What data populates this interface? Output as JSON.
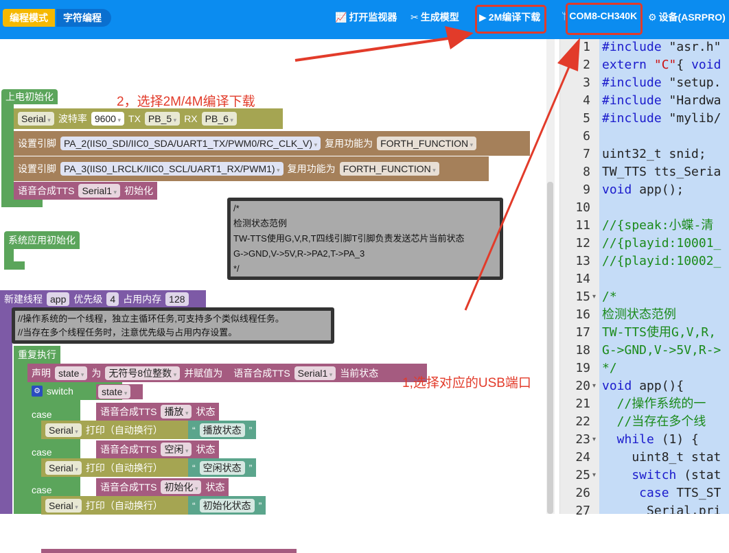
{
  "header": {
    "mode_blocks": "编程模式",
    "mode_text": "字符编程",
    "open_monitor": "打开监视器",
    "generate_model": "生成模型",
    "compile_download": "2M编译下载",
    "port": "COM8-CH340K",
    "device": "设备(ASRPRO)"
  },
  "annotations": {
    "step2": "2，选择2M/4M编译下载",
    "step1": "1,选择对应的USB端口",
    "color": "#e23b2a"
  },
  "blocks": {
    "power_init": "上电初始化",
    "serial": "Serial",
    "baud_label": "波特率",
    "baud": "9600",
    "tx": "TX",
    "tx_pin": "PB_5",
    "rx": "RX",
    "rx_pin": "PB_6",
    "set_pin": "设置引脚",
    "pin1": "PA_2(IIS0_SDI/IIC0_SDA/UART1_TX/PWM0/RC_CLK_V)",
    "reuse": "复用功能为",
    "func": "FORTH_FUNCTION",
    "pin2": "PA_3(IIS0_LRCLK/IIC0_SCL/UART1_RX/PWM1)",
    "tts": "语音合成TTS",
    "serial1": "Serial1",
    "init": "初始化",
    "sys_init": "系统应用初始化",
    "comment1": "/*\n检测状态范例\nTW-TTS使用G,V,R,T四线引脚T引脚负责发送芯片当前状态\nG->GND,V->5V,R->PA2,T->PA_3\n*/",
    "new_thread": "新建线程",
    "thread_name": "app",
    "priority": "优先级",
    "priority_val": "4",
    "memory": "占用内存",
    "memory_val": "128",
    "comment2": "//操作系统的一个线程，独立主循环任务,可支持多个类似线程任务。\n//当存在多个线程任务时，注意优先级与占用内存设置。",
    "repeat": "重复执行",
    "declare": "声明",
    "var": "state",
    "as": "为",
    "type": "无符号8位整数",
    "assign": "并赋值为",
    "current_state": "当前状态",
    "switch": "switch",
    "case": "case",
    "state_suffix": "状态",
    "print": "打印（自动换行）",
    "lq": "“",
    "rq": "”",
    "cases": [
      {
        "state": "播放",
        "text": "播放状态"
      },
      {
        "state": "空闲",
        "text": "空闲状态"
      },
      {
        "state": "初始化",
        "text": "初始化状态"
      }
    ]
  },
  "code": {
    "line_numbers": [
      "1",
      "2",
      "3",
      "4",
      "5",
      "6",
      "7",
      "8",
      "9",
      "10",
      "11",
      "12",
      "13",
      "14",
      "15",
      "16",
      "17",
      "18",
      "19",
      "20",
      "21",
      "22",
      "23",
      "24",
      "25",
      "26",
      "27"
    ],
    "folds": [
      15,
      20,
      23,
      25
    ],
    "lines": [
      [
        [
          "kw",
          "#include "
        ],
        [
          "str",
          "\"asr.h\""
        ]
      ],
      [
        [
          "kw",
          "extern "
        ],
        [
          "red",
          "\"C\""
        ],
        [
          "pl",
          "{ "
        ],
        [
          "kw",
          "void"
        ]
      ],
      [
        [
          "kw",
          "#include "
        ],
        [
          "str",
          "\"setup."
        ]
      ],
      [
        [
          "kw",
          "#include "
        ],
        [
          "str",
          "\"Hardwa"
        ]
      ],
      [
        [
          "kw",
          "#include "
        ],
        [
          "str",
          "\"mylib/"
        ]
      ],
      [],
      [
        [
          "pl",
          "uint32_t snid;"
        ]
      ],
      [
        [
          "pl",
          "TW_TTS tts_Seria"
        ]
      ],
      [
        [
          "kw",
          "void "
        ],
        [
          "pl",
          "app();"
        ]
      ],
      [],
      [
        [
          "cm",
          "//{speak:小蝶-清"
        ]
      ],
      [
        [
          "cm",
          "//{playid:10001_"
        ]
      ],
      [
        [
          "cm",
          "//{playid:10002_"
        ]
      ],
      [],
      [
        [
          "cm",
          "/*"
        ]
      ],
      [
        [
          "cm",
          "检测状态范例"
        ]
      ],
      [
        [
          "cm",
          "TW-TTS使用G,V,R,"
        ]
      ],
      [
        [
          "cm",
          "G->GND,V->5V,R->"
        ]
      ],
      [
        [
          "cm",
          "*/"
        ]
      ],
      [
        [
          "kw",
          "void "
        ],
        [
          "pl",
          "app(){"
        ]
      ],
      [
        [
          "cm",
          "  //操作系统的一"
        ]
      ],
      [
        [
          "cm",
          "  //当存在多个线"
        ]
      ],
      [
        [
          "kw",
          "  while "
        ],
        [
          "pl",
          "(1) {"
        ]
      ],
      [
        [
          "pl",
          "    uint8_t stat"
        ]
      ],
      [
        [
          "kw",
          "    switch "
        ],
        [
          "pl",
          "(stat"
        ]
      ],
      [
        [
          "kw",
          "     case "
        ],
        [
          "pl",
          "TTS_ST"
        ]
      ],
      [
        [
          "pl",
          "      Serial.pri"
        ]
      ]
    ]
  }
}
